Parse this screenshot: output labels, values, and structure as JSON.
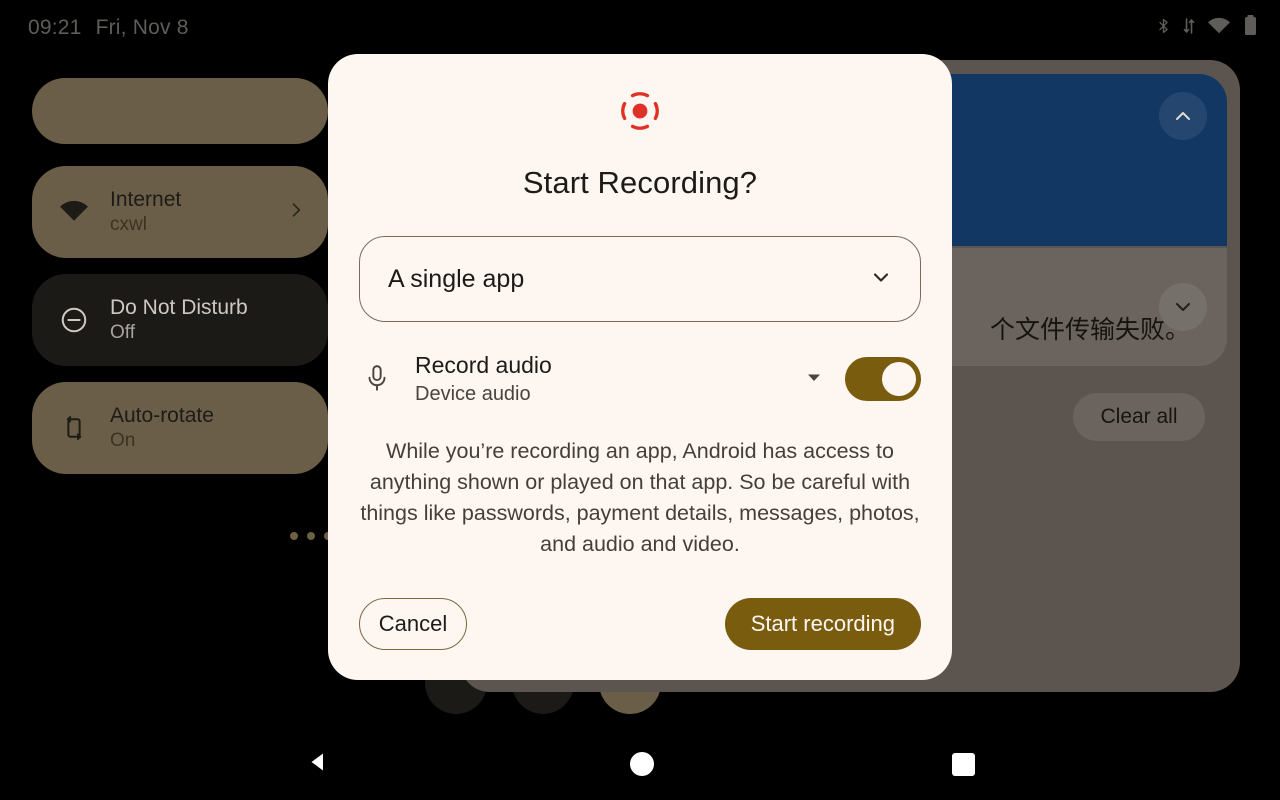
{
  "status_bar": {
    "clock": "09:21",
    "date": "Fri, Nov 8",
    "icons": [
      "bluetooth-icon",
      "data-transfer-icon",
      "wifi-icon",
      "battery-icon"
    ]
  },
  "quick_settings": {
    "tiles": [
      {
        "name": "partial-tile",
        "title": "",
        "subtitle": "",
        "state": "active"
      },
      {
        "name": "internet",
        "title": "Internet",
        "subtitle": "cxwl",
        "state": "active",
        "icon": "wifi-icon",
        "chevron": "chevron-right-icon"
      },
      {
        "name": "do-not-disturb",
        "title": "Do Not Disturb",
        "subtitle": "Off",
        "state": "inactive",
        "icon": "do-not-disturb-icon"
      },
      {
        "name": "auto-rotate",
        "title": "Auto-rotate",
        "subtitle": "On",
        "state": "active",
        "icon": "auto-rotate-icon"
      }
    ],
    "page_dots": 3
  },
  "notifications": {
    "blue_card_expander": "chevron-up-icon",
    "grey_card_expander": "chevron-down-icon",
    "grey_card_text": "个文件传输失败。",
    "clear_all_label": "Clear all"
  },
  "dialog": {
    "icon": "screen-record-icon",
    "title": "Start Recording?",
    "source_select": {
      "value": "A single app",
      "chevron": "chevron-down-icon"
    },
    "audio": {
      "icon": "microphone-icon",
      "title": "Record audio",
      "subtitle": "Device audio",
      "caret": "caret-down-icon",
      "toggle_on": true
    },
    "disclaimer": "While you’re recording an app, Android has access to anything shown or played on that app. So be careful with things like passwords, payment details, messages, photos, and audio and video.",
    "cancel_label": "Cancel",
    "start_label": "Start recording"
  },
  "nav_bar": {
    "back": "back-triangle-icon",
    "home": "home-circle-icon",
    "recents": "recents-square-icon"
  },
  "colors": {
    "dialog_bg": "#FDF6F1",
    "accent_gold": "#7A5C0F",
    "record_red": "#E03127",
    "tile_active": "#6B5E49",
    "tile_inactive": "#1B1A17",
    "shade_grey": "#5C554F",
    "notification_blue": "#133763"
  }
}
